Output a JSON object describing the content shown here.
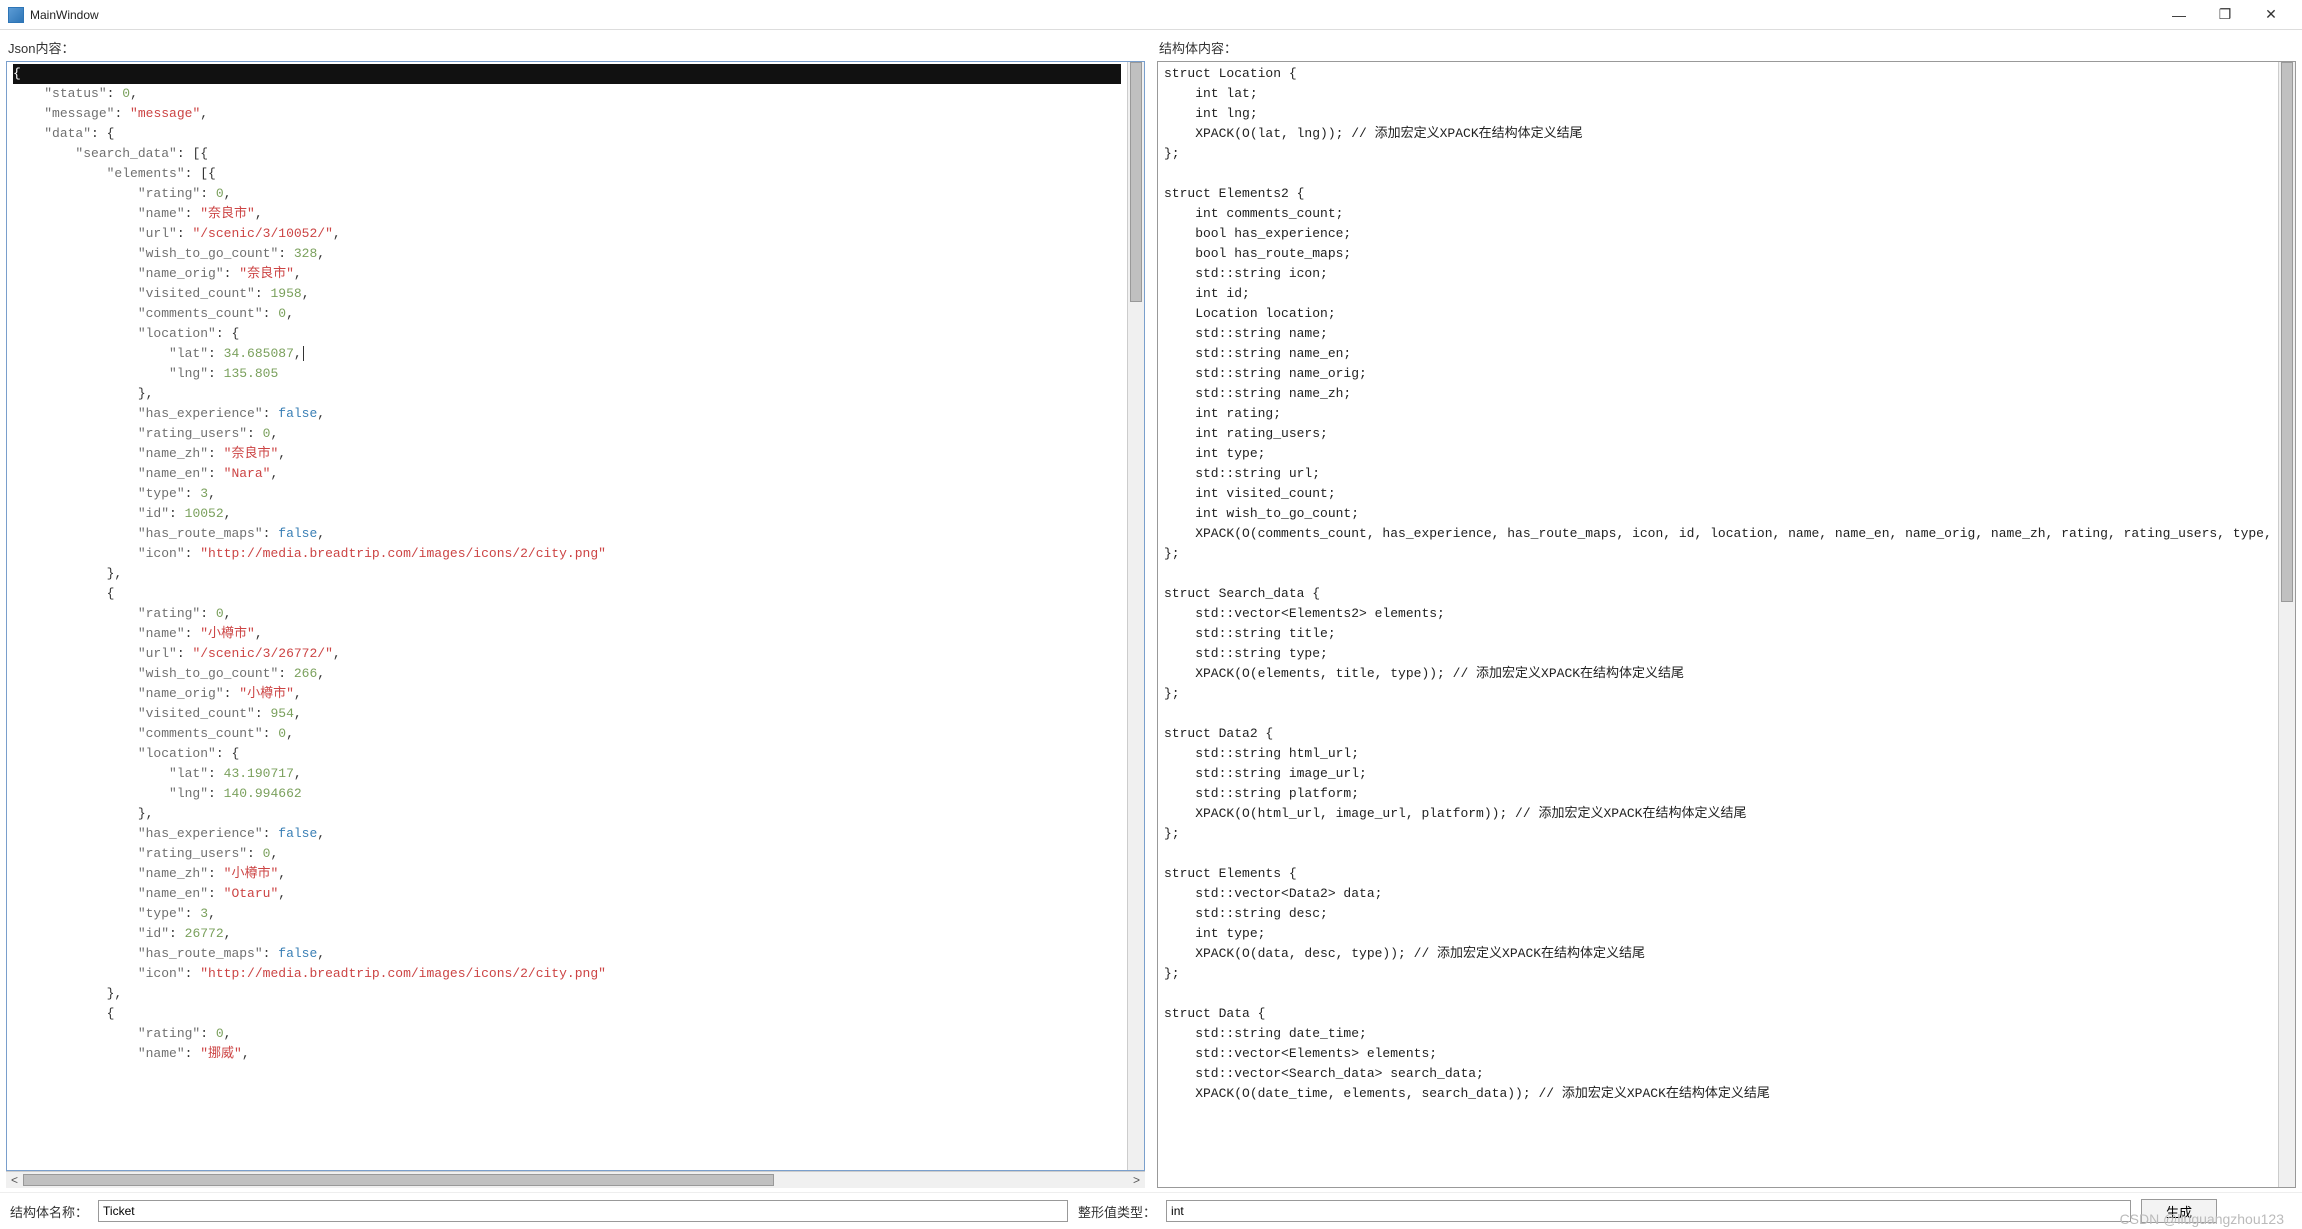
{
  "window": {
    "title": "MainWindow"
  },
  "left_panel": {
    "label": "Json内容：",
    "json_tokens": [
      {
        "indent": 0,
        "type": "sel",
        "text": "{"
      },
      {
        "indent": 1,
        "kv": [
          [
            "status",
            "num",
            "0"
          ]
        ],
        "trail": ","
      },
      {
        "indent": 1,
        "kv": [
          [
            "message",
            "str",
            "message"
          ]
        ],
        "trail": ","
      },
      {
        "indent": 1,
        "kv": [
          [
            "data",
            "open",
            "{"
          ]
        ]
      },
      {
        "indent": 2,
        "kv": [
          [
            "search_data",
            "open",
            "[{"
          ]
        ]
      },
      {
        "indent": 3,
        "kv": [
          [
            "elements",
            "open",
            "[{"
          ]
        ]
      },
      {
        "indent": 4,
        "kv": [
          [
            "rating",
            "num",
            "0"
          ]
        ],
        "trail": ","
      },
      {
        "indent": 4,
        "kv": [
          [
            "name",
            "str",
            "奈良市"
          ]
        ],
        "trail": ","
      },
      {
        "indent": 4,
        "kv": [
          [
            "url",
            "str",
            "/scenic/3/10052/"
          ]
        ],
        "trail": ","
      },
      {
        "indent": 4,
        "kv": [
          [
            "wish_to_go_count",
            "num",
            "328"
          ]
        ],
        "trail": ","
      },
      {
        "indent": 4,
        "kv": [
          [
            "name_orig",
            "str",
            "奈良市"
          ]
        ],
        "trail": ","
      },
      {
        "indent": 4,
        "kv": [
          [
            "visited_count",
            "num",
            "1958"
          ]
        ],
        "trail": ","
      },
      {
        "indent": 4,
        "kv": [
          [
            "comments_count",
            "num",
            "0"
          ]
        ],
        "trail": ","
      },
      {
        "indent": 4,
        "kv": [
          [
            "location",
            "open",
            "{"
          ]
        ]
      },
      {
        "indent": 5,
        "kv": [
          [
            "lat",
            "num",
            "34.685087"
          ]
        ],
        "trail": ",",
        "caret": true
      },
      {
        "indent": 5,
        "kv": [
          [
            "lng",
            "num",
            "135.805"
          ]
        ]
      },
      {
        "indent": 4,
        "close": "},"
      },
      {
        "indent": 4,
        "kv": [
          [
            "has_experience",
            "bool",
            "false"
          ]
        ],
        "trail": ","
      },
      {
        "indent": 4,
        "kv": [
          [
            "rating_users",
            "num",
            "0"
          ]
        ],
        "trail": ","
      },
      {
        "indent": 4,
        "kv": [
          [
            "name_zh",
            "str",
            "奈良市"
          ]
        ],
        "trail": ","
      },
      {
        "indent": 4,
        "kv": [
          [
            "name_en",
            "str",
            "Nara"
          ]
        ],
        "trail": ","
      },
      {
        "indent": 4,
        "kv": [
          [
            "type",
            "num",
            "3"
          ]
        ],
        "trail": ","
      },
      {
        "indent": 4,
        "kv": [
          [
            "id",
            "num",
            "10052"
          ]
        ],
        "trail": ","
      },
      {
        "indent": 4,
        "kv": [
          [
            "has_route_maps",
            "bool",
            "false"
          ]
        ],
        "trail": ","
      },
      {
        "indent": 4,
        "kv": [
          [
            "icon",
            "str",
            "http://media.breadtrip.com/images/icons/2/city.png"
          ]
        ]
      },
      {
        "indent": 3,
        "close": "},"
      },
      {
        "indent": 3,
        "close": "{"
      },
      {
        "indent": 4,
        "kv": [
          [
            "rating",
            "num",
            "0"
          ]
        ],
        "trail": ","
      },
      {
        "indent": 4,
        "kv": [
          [
            "name",
            "str",
            "小樽市"
          ]
        ],
        "trail": ","
      },
      {
        "indent": 4,
        "kv": [
          [
            "url",
            "str",
            "/scenic/3/26772/"
          ]
        ],
        "trail": ","
      },
      {
        "indent": 4,
        "kv": [
          [
            "wish_to_go_count",
            "num",
            "266"
          ]
        ],
        "trail": ","
      },
      {
        "indent": 4,
        "kv": [
          [
            "name_orig",
            "str",
            "小樽市"
          ]
        ],
        "trail": ","
      },
      {
        "indent": 4,
        "kv": [
          [
            "visited_count",
            "num",
            "954"
          ]
        ],
        "trail": ","
      },
      {
        "indent": 4,
        "kv": [
          [
            "comments_count",
            "num",
            "0"
          ]
        ],
        "trail": ","
      },
      {
        "indent": 4,
        "kv": [
          [
            "location",
            "open",
            "{"
          ]
        ]
      },
      {
        "indent": 5,
        "kv": [
          [
            "lat",
            "num",
            "43.190717"
          ]
        ],
        "trail": ","
      },
      {
        "indent": 5,
        "kv": [
          [
            "lng",
            "num",
            "140.994662"
          ]
        ]
      },
      {
        "indent": 4,
        "close": "},"
      },
      {
        "indent": 4,
        "kv": [
          [
            "has_experience",
            "bool",
            "false"
          ]
        ],
        "trail": ","
      },
      {
        "indent": 4,
        "kv": [
          [
            "rating_users",
            "num",
            "0"
          ]
        ],
        "trail": ","
      },
      {
        "indent": 4,
        "kv": [
          [
            "name_zh",
            "str",
            "小樽市"
          ]
        ],
        "trail": ","
      },
      {
        "indent": 4,
        "kv": [
          [
            "name_en",
            "str",
            "Otaru"
          ]
        ],
        "trail": ","
      },
      {
        "indent": 4,
        "kv": [
          [
            "type",
            "num",
            "3"
          ]
        ],
        "trail": ","
      },
      {
        "indent": 4,
        "kv": [
          [
            "id",
            "num",
            "26772"
          ]
        ],
        "trail": ","
      },
      {
        "indent": 4,
        "kv": [
          [
            "has_route_maps",
            "bool",
            "false"
          ]
        ],
        "trail": ","
      },
      {
        "indent": 4,
        "kv": [
          [
            "icon",
            "str",
            "http://media.breadtrip.com/images/icons/2/city.png"
          ]
        ]
      },
      {
        "indent": 3,
        "close": "},"
      },
      {
        "indent": 3,
        "close": "{"
      },
      {
        "indent": 4,
        "kv": [
          [
            "rating",
            "num",
            "0"
          ]
        ],
        "trail": ","
      },
      {
        "indent": 4,
        "kv": [
          [
            "name",
            "str",
            "挪威"
          ]
        ],
        "trail": ","
      }
    ]
  },
  "right_panel": {
    "label": "结构体内容：",
    "lines": [
      "struct Location {",
      "    int lat;",
      "    int lng;",
      "    XPACK(O(lat, lng)); // 添加宏定义XPACK在结构体定义结尾",
      "};",
      "",
      "struct Elements2 {",
      "    int comments_count;",
      "    bool has_experience;",
      "    bool has_route_maps;",
      "    std::string icon;",
      "    int id;",
      "    Location location;",
      "    std::string name;",
      "    std::string name_en;",
      "    std::string name_orig;",
      "    std::string name_zh;",
      "    int rating;",
      "    int rating_users;",
      "    int type;",
      "    std::string url;",
      "    int visited_count;",
      "    int wish_to_go_count;",
      "    XPACK(O(comments_count, has_experience, has_route_maps, icon, id, location, name, name_en, name_orig, name_zh, rating, rating_users, type, url, visited_count, wish_to_go_count)); // 添加宏定义XPACK在结构体定义结尾",
      "};",
      "",
      "struct Search_data {",
      "    std::vector<Elements2> elements;",
      "    std::string title;",
      "    std::string type;",
      "    XPACK(O(elements, title, type)); // 添加宏定义XPACK在结构体定义结尾",
      "};",
      "",
      "struct Data2 {",
      "    std::string html_url;",
      "    std::string image_url;",
      "    std::string platform;",
      "    XPACK(O(html_url, image_url, platform)); // 添加宏定义XPACK在结构体定义结尾",
      "};",
      "",
      "struct Elements {",
      "    std::vector<Data2> data;",
      "    std::string desc;",
      "    int type;",
      "    XPACK(O(data, desc, type)); // 添加宏定义XPACK在结构体定义结尾",
      "};",
      "",
      "struct Data {",
      "    std::string date_time;",
      "    std::vector<Elements> elements;",
      "    std::vector<Search_data> search_data;",
      "    XPACK(O(date_time, elements, search_data)); // 添加宏定义XPACK在结构体定义结尾"
    ]
  },
  "bottom": {
    "struct_name_label": "结构体名称：",
    "struct_name_value": "Ticket",
    "int_type_label": "整形值类型：",
    "int_type_value": "int",
    "generate_button": "生成"
  },
  "watermark": "CSDN @liuguangzhou123"
}
